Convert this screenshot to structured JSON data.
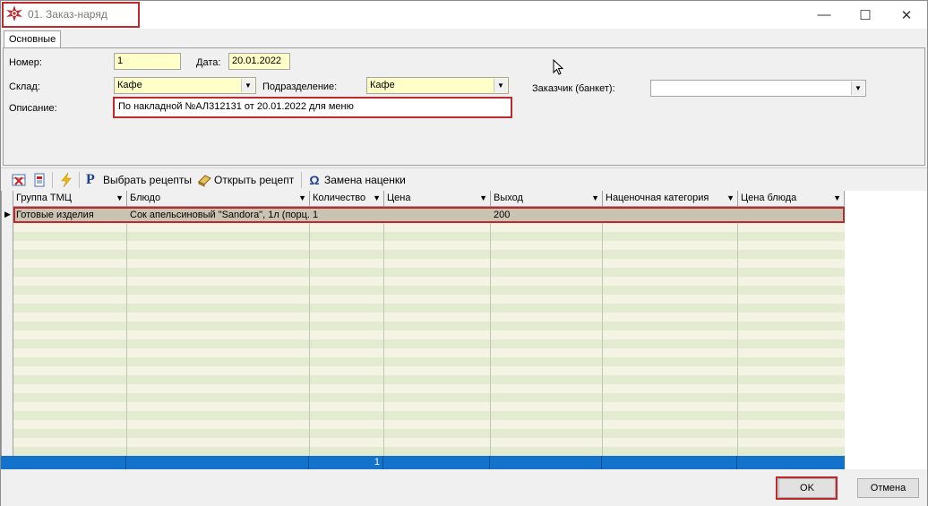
{
  "window": {
    "title": "01. Заказ-наряд",
    "minimize": "—",
    "maximize": "☐",
    "close": "✕"
  },
  "tabs": [
    {
      "label": "Основные"
    }
  ],
  "form": {
    "number_label": "Номер:",
    "number_value": "1",
    "date_label": "Дата:",
    "date_value": "20.01.2022",
    "warehouse_label": "Склад:",
    "warehouse_value": "Кафе",
    "division_label": "Подразделение:",
    "division_value": "Кафе",
    "customer_label": "Заказчик (банкет):",
    "customer_value": "",
    "description_label": "Описание:",
    "description_value": "По накладной №АЛ312131 от 20.01.2022 для меню"
  },
  "toolbar": {
    "select_recipes": "Выбрать рецепты",
    "open_recipe": "Открыть рецепт",
    "replace_markup": "Замена наценки"
  },
  "grid": {
    "columns": [
      "Группа ТМЦ",
      "Блюдо",
      "Количество",
      "Цена",
      "Выход",
      "Наценочная категория",
      "Цена блюда"
    ],
    "rows": [
      [
        "Готовые изделия",
        "Сок апельсиновый \"Sandora\", 1л (порц.",
        "1",
        "",
        "200",
        "",
        ""
      ]
    ],
    "footer": {
      "quantity_total": "1"
    }
  },
  "buttons": {
    "ok": "OK",
    "cancel": "Отмена"
  },
  "colors": {
    "highlight": "#c0282d",
    "footer": "#1272cc",
    "required_field": "#ffffc8"
  }
}
